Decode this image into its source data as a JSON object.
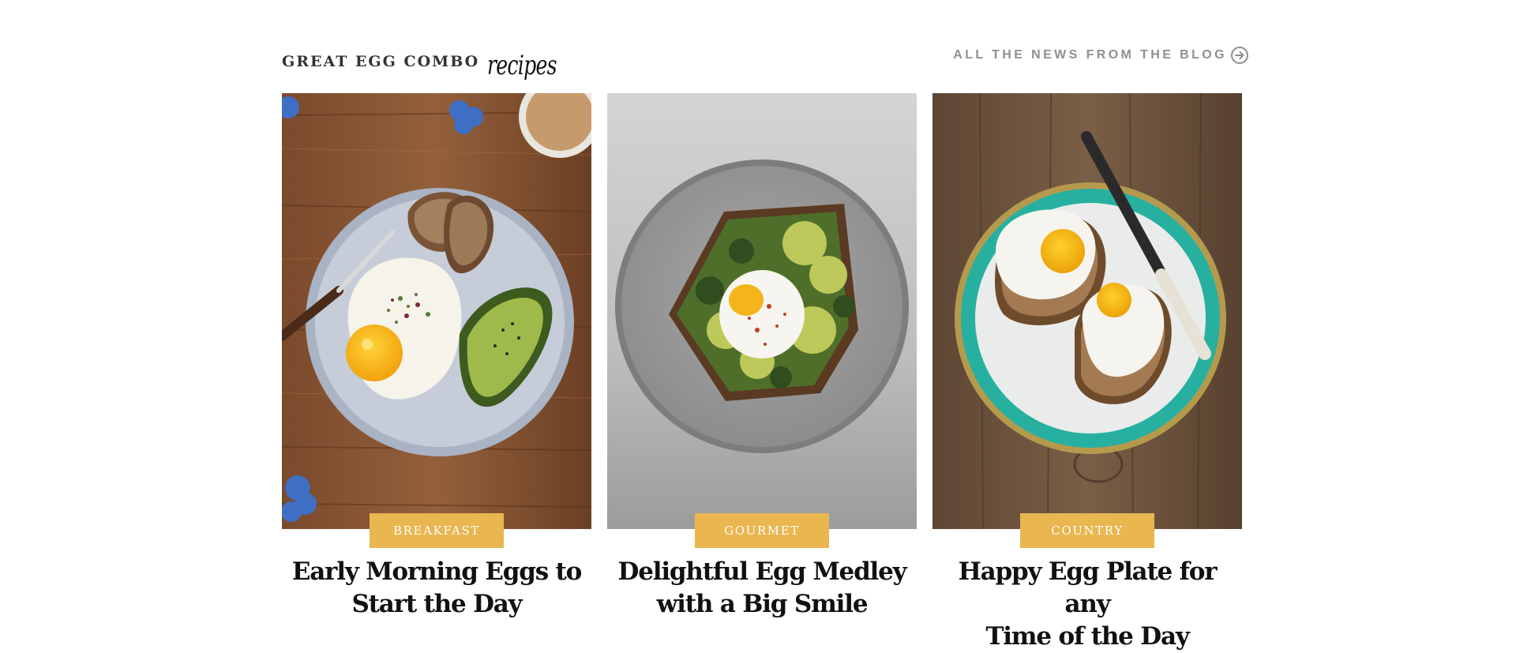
{
  "header": {
    "title": "GREAT EGG COMBO",
    "title_script": "recipes",
    "blog_link_label": "ALL THE NEWS FROM THE BLOG",
    "blog_link_icon": "arrow-right-circle-icon"
  },
  "colors": {
    "tag_background": "#e9b650",
    "tag_text": "#ffffff",
    "title_text": "#111111",
    "header_text": "#333333",
    "link_text": "#8f8f8f"
  },
  "cards": [
    {
      "image": "fried egg, toast and avocado on a blue plate on a wooden table",
      "category": "BREAKFAST",
      "title_line1": "Early Morning Eggs to",
      "title_line2": "Start the Day"
    },
    {
      "image": "poached egg on avocado toast on a grey stone plate",
      "category": "GOURMET",
      "title_line1": "Delightful Egg Medley",
      "title_line2": "with a Big Smile"
    },
    {
      "image": "two fried eggs on toast on a teal rimmed plate with a knife",
      "category": "COUNTRY",
      "title_line1": "Happy Egg Plate for any",
      "title_line2": "Time of the Day"
    }
  ]
}
